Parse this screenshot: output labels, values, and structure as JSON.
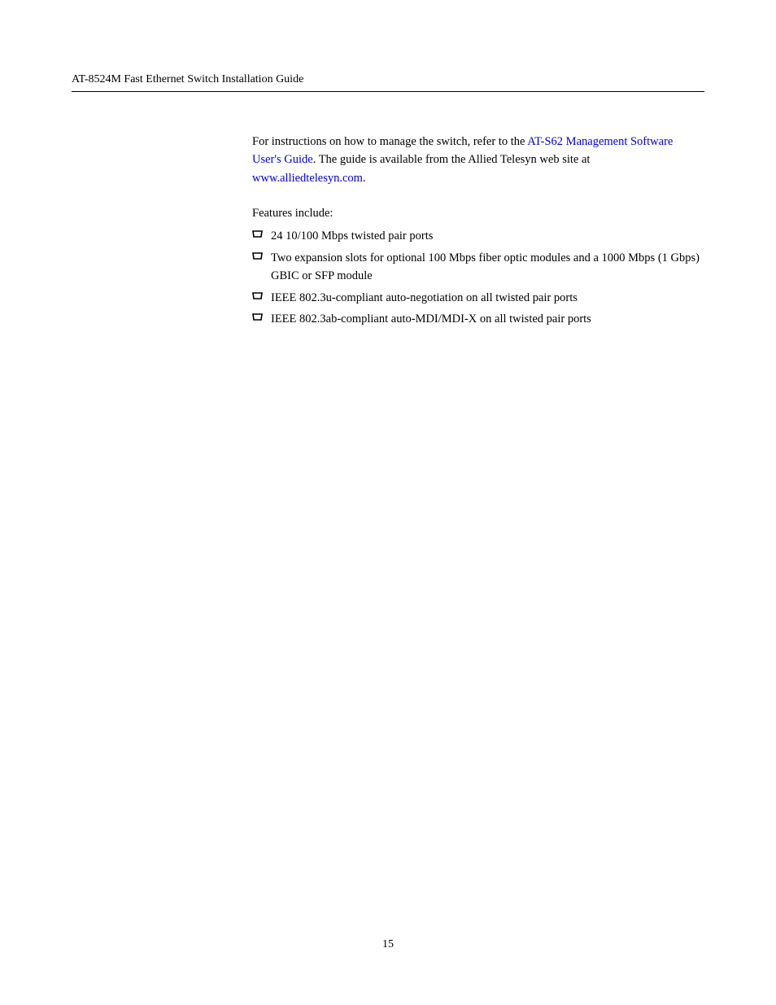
{
  "header": {
    "left": "AT-8524M Fast Ethernet Switch Installation Guide",
    "right": ""
  },
  "content": {
    "intro_before_link": "For instructions on how to manage the switch, refer to the ",
    "intro_link_text": "AT-S62 Management Software User's Guide",
    "intro_after_link": ". The guide is available from the Allied Telesyn web site at ",
    "intro_url": "www.alliedtelesyn.com",
    "intro_period": ".",
    "section_label": "Features include:",
    "features": [
      "24 10/100 Mbps twisted pair ports",
      "Two expansion slots for optional 100 Mbps fiber optic modules and a 1000 Mbps (1 Gbps) GBIC or SFP module",
      "IEEE 802.3u-compliant auto-negotiation on all twisted pair ports",
      "IEEE 802.3ab-compliant auto-MDI/MDI-X on all twisted pair ports"
    ]
  },
  "footer": {
    "page_number": "15"
  }
}
